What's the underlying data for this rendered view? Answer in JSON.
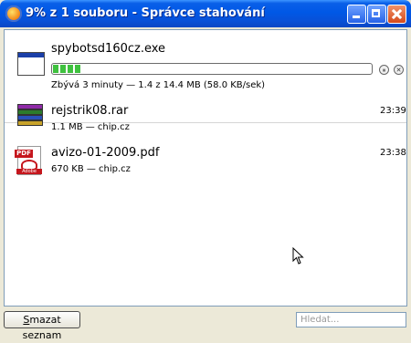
{
  "window": {
    "title": "9% z 1 souboru - Správce stahování"
  },
  "downloads": [
    {
      "filename": "spybotsd160cz.exe",
      "status": "Zbývá 3 minuty — 1.4 z 14.4 MB (58.0 KB/sek)",
      "progress_percent": 9,
      "icon": "exe-window-icon",
      "pause_icon": "⏸",
      "cancel_icon": "✕"
    },
    {
      "filename": "rejstrik08.rar",
      "status": "1.1 MB — chip.cz",
      "time": "23:39",
      "icon": "rar-archive-icon"
    },
    {
      "filename": "avizo-01-2009.pdf",
      "status": "670 KB — chip.cz",
      "time": "23:38",
      "icon": "pdf-document-icon",
      "badge": "PDF",
      "brand": "Adobe"
    }
  ],
  "footer": {
    "clear_label_underlined": "S",
    "clear_label_rest": "mazat seznam",
    "search_placeholder": "Hledat..."
  }
}
